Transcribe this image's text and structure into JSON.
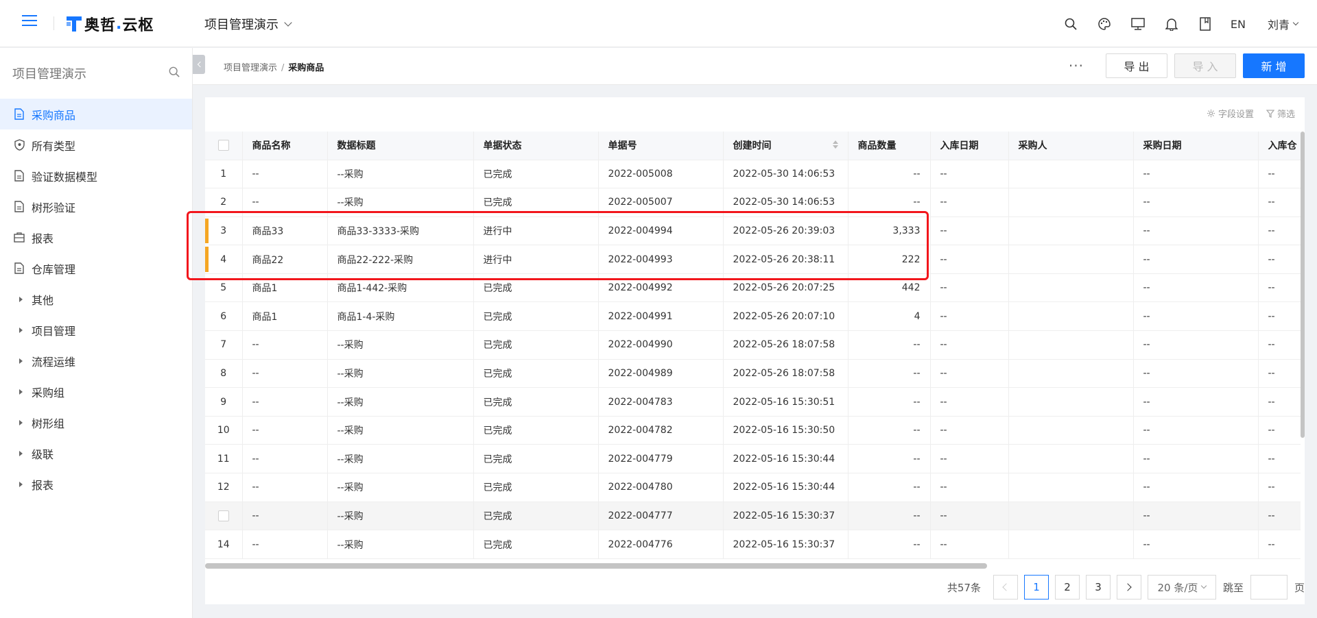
{
  "header": {
    "brand_main": "奥哲",
    "brand_dot": ".",
    "brand_sub": "云枢",
    "project_name": "项目管理演示",
    "lang": "EN",
    "user": "刘青"
  },
  "sidebar": {
    "title": "项目管理演示",
    "items": [
      {
        "label": "采购商品",
        "icon": "document-icon",
        "active": true
      },
      {
        "label": "所有类型",
        "icon": "shield-icon"
      },
      {
        "label": "验证数据模型",
        "icon": "document-icon"
      },
      {
        "label": "树形验证",
        "icon": "document-icon"
      },
      {
        "label": "报表",
        "icon": "report-icon"
      },
      {
        "label": "仓库管理",
        "icon": "document-icon"
      }
    ],
    "groups": [
      "其他",
      "项目管理",
      "流程运维",
      "采购组",
      "树形组",
      "级联",
      "报表"
    ]
  },
  "breadcrumb": {
    "parent": "项目管理演示",
    "sep": "/",
    "current": "采购商品"
  },
  "actions": {
    "more": "···",
    "export": "导 出",
    "import": "导 入",
    "add": "新 增"
  },
  "tools": {
    "field_settings": "字段设置",
    "filter": "筛选"
  },
  "table": {
    "columns": [
      "商品名称",
      "数据标题",
      "单据状态",
      "单据号",
      "创建时间",
      "商品数量",
      "入库日期",
      "采购人",
      "采购日期",
      "入库仓"
    ],
    "rows": [
      {
        "idx": "1",
        "name": "--",
        "title": "--采购",
        "status": "已完成",
        "no": "2022-005008",
        "created": "2022-05-30 14:06:53",
        "qty": "--",
        "in_date": "--",
        "buyer": "",
        "buy_date": "--",
        "warehouse": "--"
      },
      {
        "idx": "2",
        "name": "--",
        "title": "--采购",
        "status": "已完成",
        "no": "2022-005007",
        "created": "2022-05-30 14:06:53",
        "qty": "--",
        "in_date": "--",
        "buyer": "",
        "buy_date": "--",
        "warehouse": "--"
      },
      {
        "idx": "3",
        "name": "商品33",
        "title": "商品33-3333-采购",
        "status": "进行中",
        "no": "2022-004994",
        "created": "2022-05-26 20:39:03",
        "qty": "3,333",
        "in_date": "--",
        "buyer": "",
        "buy_date": "--",
        "warehouse": "--"
      },
      {
        "idx": "4",
        "name": "商品22",
        "title": "商品22-222-采购",
        "status": "进行中",
        "no": "2022-004993",
        "created": "2022-05-26 20:38:11",
        "qty": "222",
        "in_date": "--",
        "buyer": "",
        "buy_date": "--",
        "warehouse": "--"
      },
      {
        "idx": "5",
        "name": "商品1",
        "title": "商品1-442-采购",
        "status": "已完成",
        "no": "2022-004992",
        "created": "2022-05-26 20:07:25",
        "qty": "442",
        "in_date": "--",
        "buyer": "",
        "buy_date": "--",
        "warehouse": "--"
      },
      {
        "idx": "6",
        "name": "商品1",
        "title": "商品1-4-采购",
        "status": "已完成",
        "no": "2022-004991",
        "created": "2022-05-26 20:07:10",
        "qty": "4",
        "in_date": "--",
        "buyer": "",
        "buy_date": "--",
        "warehouse": "--"
      },
      {
        "idx": "7",
        "name": "--",
        "title": "--采购",
        "status": "已完成",
        "no": "2022-004990",
        "created": "2022-05-26 18:07:58",
        "qty": "--",
        "in_date": "--",
        "buyer": "",
        "buy_date": "--",
        "warehouse": "--"
      },
      {
        "idx": "8",
        "name": "--",
        "title": "--采购",
        "status": "已完成",
        "no": "2022-004989",
        "created": "2022-05-26 18:07:58",
        "qty": "--",
        "in_date": "--",
        "buyer": "",
        "buy_date": "--",
        "warehouse": "--"
      },
      {
        "idx": "9",
        "name": "--",
        "title": "--采购",
        "status": "已完成",
        "no": "2022-004783",
        "created": "2022-05-16 15:30:51",
        "qty": "--",
        "in_date": "--",
        "buyer": "",
        "buy_date": "--",
        "warehouse": "--"
      },
      {
        "idx": "10",
        "name": "--",
        "title": "--采购",
        "status": "已完成",
        "no": "2022-004782",
        "created": "2022-05-16 15:30:50",
        "qty": "--",
        "in_date": "--",
        "buyer": "",
        "buy_date": "--",
        "warehouse": "--"
      },
      {
        "idx": "11",
        "name": "--",
        "title": "--采购",
        "status": "已完成",
        "no": "2022-004779",
        "created": "2022-05-16 15:30:44",
        "qty": "--",
        "in_date": "--",
        "buyer": "",
        "buy_date": "--",
        "warehouse": "--"
      },
      {
        "idx": "12",
        "name": "--",
        "title": "--采购",
        "status": "已完成",
        "no": "2022-004780",
        "created": "2022-05-16 15:30:44",
        "qty": "--",
        "in_date": "--",
        "buyer": "",
        "buy_date": "--",
        "warehouse": "--"
      },
      {
        "idx": "",
        "name": "--",
        "title": "--采购",
        "status": "已完成",
        "no": "2022-004777",
        "created": "2022-05-16 15:30:37",
        "qty": "--",
        "in_date": "--",
        "buyer": "",
        "buy_date": "--",
        "warehouse": "--"
      },
      {
        "idx": "14",
        "name": "--",
        "title": "--采购",
        "status": "已完成",
        "no": "2022-004776",
        "created": "2022-05-16 15:30:37",
        "qty": "--",
        "in_date": "--",
        "buyer": "",
        "buy_date": "--",
        "warehouse": "--"
      }
    ]
  },
  "pagination": {
    "total": "共57条",
    "pages": [
      "1",
      "2",
      "3"
    ],
    "current": "1",
    "page_size": "20 条/页",
    "jump_label": "跳至",
    "page_label": "页"
  },
  "colors": {
    "primary": "#1677ff",
    "highlight_bar": "#f5a623",
    "annotation_box": "#f2161c"
  }
}
